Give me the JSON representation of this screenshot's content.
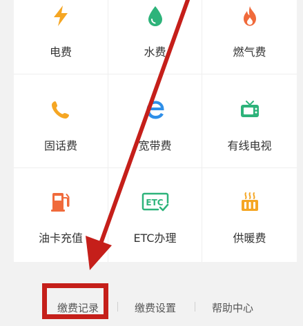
{
  "colors": {
    "orange": "#f5a623",
    "green": "#2db37a",
    "flame": "#f06a3b",
    "blue": "#2f8fe8",
    "annotation_red": "#c51f1a"
  },
  "services": [
    {
      "label": "电费",
      "icon": "lightning-icon"
    },
    {
      "label": "水费",
      "icon": "water-drop-icon"
    },
    {
      "label": "燃气费",
      "icon": "flame-icon"
    },
    {
      "label": "固话费",
      "icon": "phone-icon"
    },
    {
      "label": "宽带费",
      "icon": "ie-browser-icon"
    },
    {
      "label": "有线电视",
      "icon": "tv-icon"
    },
    {
      "label": "油卡充值",
      "icon": "gas-pump-icon"
    },
    {
      "label": "ETC办理",
      "icon": "etc-icon"
    },
    {
      "label": "供暖费",
      "icon": "heating-icon"
    }
  ],
  "etc_icon_text": "ETC",
  "footer": {
    "payment_records": "缴费记录",
    "payment_settings": "缴费设置",
    "help_center": "帮助中心"
  }
}
